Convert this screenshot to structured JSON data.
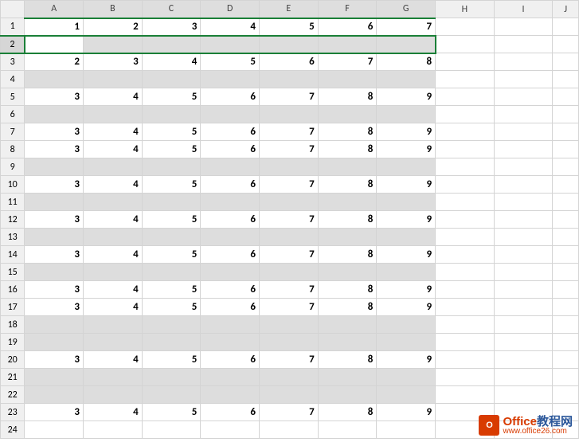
{
  "columns": [
    "A",
    "B",
    "C",
    "D",
    "E",
    "F",
    "G",
    "H",
    "I",
    "J"
  ],
  "row_count": 24,
  "selection": {
    "row": 2,
    "range": "A2:G2"
  },
  "data_rows": {
    "1": [
      "1",
      "2",
      "3",
      "4",
      "5",
      "6",
      "7"
    ],
    "3": [
      "2",
      "3",
      "4",
      "5",
      "6",
      "7",
      "8"
    ],
    "5": [
      "3",
      "4",
      "5",
      "6",
      "7",
      "8",
      "9"
    ],
    "7": [
      "3",
      "4",
      "5",
      "6",
      "7",
      "8",
      "9"
    ],
    "8": [
      "3",
      "4",
      "5",
      "6",
      "7",
      "8",
      "9"
    ],
    "10": [
      "3",
      "4",
      "5",
      "6",
      "7",
      "8",
      "9"
    ],
    "12": [
      "3",
      "4",
      "5",
      "6",
      "7",
      "8",
      "9"
    ],
    "14": [
      "3",
      "4",
      "5",
      "6",
      "7",
      "8",
      "9"
    ],
    "16": [
      "3",
      "4",
      "5",
      "6",
      "7",
      "8",
      "9"
    ],
    "17": [
      "3",
      "4",
      "5",
      "6",
      "7",
      "8",
      "9"
    ],
    "20": [
      "3",
      "4",
      "5",
      "6",
      "7",
      "8",
      "9"
    ],
    "23": [
      "3",
      "4",
      "5",
      "6",
      "7",
      "8",
      "9"
    ]
  },
  "blank_shaded_rows": [
    2,
    4,
    6,
    9,
    11,
    13,
    15,
    18,
    19,
    21,
    22
  ],
  "watermark": {
    "icon_text": "O",
    "title_part1": "Office",
    "title_part2": "教程网",
    "subtitle": "www.office26.com"
  }
}
